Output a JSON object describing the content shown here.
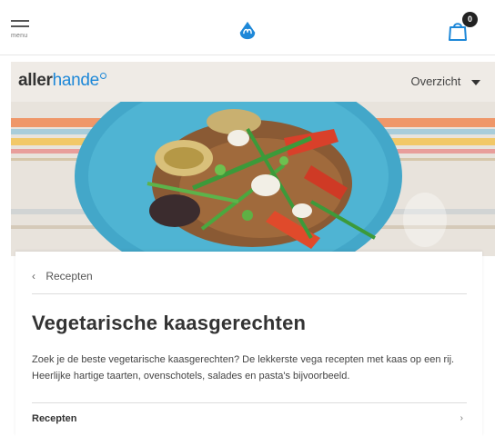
{
  "header": {
    "menu_label": "menu",
    "cart_count": "0"
  },
  "allerhande": {
    "brand_part1": "aller",
    "brand_part2": "hande",
    "overview_label": "Overzicht"
  },
  "hero": {
    "image_desc": "vegetarian salad plate"
  },
  "content": {
    "back_label": "Recepten",
    "title": "Vegetarische kaasgerechten",
    "intro": "Zoek je de beste vegetarische kaasgerechten? De lekkerste vega recepten met kaas op een rij. Heerlijke hartige taarten, ovenschotels, salades en pasta's bijvoorbeeld.",
    "list": [
      {
        "label": "Recepten",
        "arrow": "›"
      }
    ]
  },
  "colors": {
    "brand_blue": "#1e88d8",
    "bar_beige": "#efebe6"
  }
}
